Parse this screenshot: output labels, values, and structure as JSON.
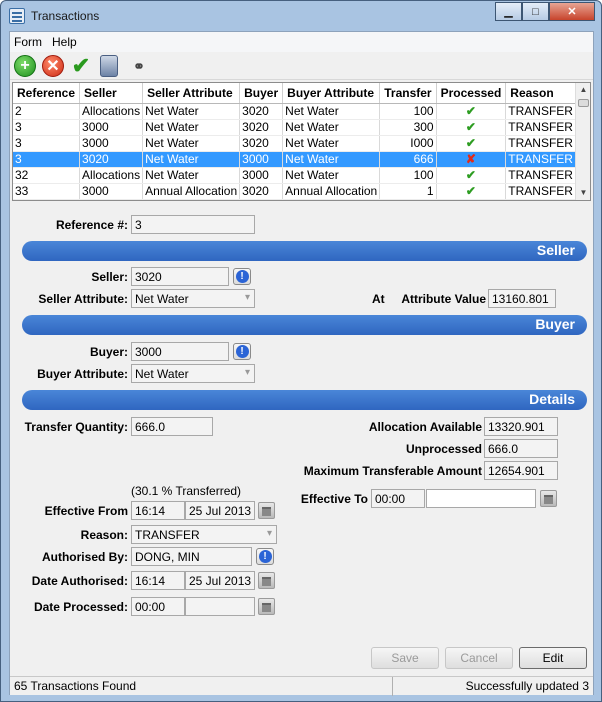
{
  "window": {
    "title": "Transactions"
  },
  "menu": {
    "form": "Form",
    "help": "Help"
  },
  "grid": {
    "columns": [
      "Reference",
      "Seller",
      "Seller Attribute",
      "Buyer",
      "Buyer Attribute",
      "Transfer",
      "Processed",
      "Reason"
    ],
    "rows": [
      {
        "ref": "2",
        "seller": "Allocations",
        "seller_attr": "Net Water",
        "buyer": "3020",
        "buyer_attr": "Net Water",
        "transfer": "100",
        "processed": "check",
        "reason": "TRANSFER"
      },
      {
        "ref": "3",
        "seller": "3000",
        "seller_attr": "Net Water",
        "buyer": "3020",
        "buyer_attr": "Net Water",
        "transfer": "300",
        "processed": "check",
        "reason": "TRANSFER"
      },
      {
        "ref": "3",
        "seller": "3000",
        "seller_attr": "Net Water",
        "buyer": "3020",
        "buyer_attr": "Net Water",
        "transfer": "I000",
        "processed": "check",
        "reason": "TRANSFER"
      },
      {
        "ref": "3",
        "seller": "3020",
        "seller_attr": "Net Water",
        "buyer": "3000",
        "buyer_attr": "Net Water",
        "transfer": "666",
        "processed": "cross",
        "reason": "TRANSFER",
        "selected": true
      },
      {
        "ref": "32",
        "seller": "Allocations",
        "seller_attr": "Net Water",
        "buyer": "3000",
        "buyer_attr": "Net Water",
        "transfer": "100",
        "processed": "check",
        "reason": "TRANSFER"
      },
      {
        "ref": "33",
        "seller": "3000",
        "seller_attr": "Annual Allocation",
        "buyer": "3020",
        "buyer_attr": "Annual Allocation",
        "transfer": "1",
        "processed": "check",
        "reason": "TRANSFER"
      }
    ]
  },
  "form": {
    "reference_label": "Reference #:",
    "reference_value": "3",
    "seller_band": "Seller",
    "seller_label": "Seller:",
    "seller_value": "3020",
    "seller_attr_label": "Seller Attribute:",
    "seller_attr_value": "Net Water",
    "at_label": "At",
    "attr_value_label": "Attribute Value",
    "attr_value": "13160.801",
    "buyer_band": "Buyer",
    "buyer_label": "Buyer:",
    "buyer_value": "3000",
    "buyer_attr_label": "Buyer Attribute:",
    "buyer_attr_value": "Net Water",
    "details_band": "Details",
    "transfer_qty_label": "Transfer Quantity:",
    "transfer_qty_value": "666.0",
    "alloc_avail_label": "Allocation Available",
    "alloc_avail_value": "13320.901",
    "unprocessed_label": "Unprocessed",
    "unprocessed_value": "666.0",
    "max_transferable_label": "Maximum Transferable Amount",
    "max_transferable_value": "12654.901",
    "percent_note": "(30.1 % Transferred)",
    "effective_from_label": "Effective From",
    "effective_from_time": "16:14",
    "effective_from_date": "25 Jul 2013",
    "effective_to_label": "Effective To",
    "effective_to_time": "00:00",
    "effective_to_date": "",
    "reason_label": "Reason:",
    "reason_value": "TRANSFER",
    "authorised_by_label": "Authorised By:",
    "authorised_by_value": "DONG, MIN",
    "date_authorised_label": "Date Authorised:",
    "date_authorised_time": "16:14",
    "date_authorised_date": "25 Jul 2013",
    "date_processed_label": "Date Processed:",
    "date_processed_time": "00:00",
    "date_processed_date": ""
  },
  "buttons": {
    "save": "Save",
    "cancel": "Cancel",
    "edit": "Edit"
  },
  "status": {
    "left": "65 Transactions Found",
    "right": "Successfully updated 3"
  }
}
